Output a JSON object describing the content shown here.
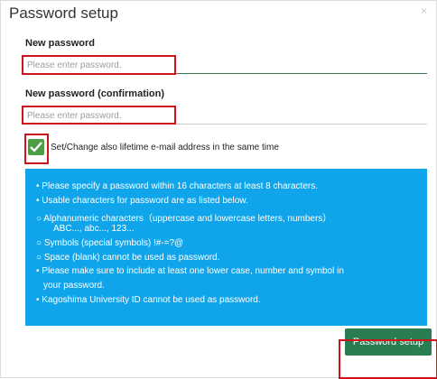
{
  "dialog": {
    "title": "Password setup",
    "close_symbol": "×"
  },
  "new_password": {
    "label": "New password",
    "placeholder": "Please enter password.",
    "value": ""
  },
  "confirm_password": {
    "label": "New password (confirmation)",
    "placeholder": "Please enter password.",
    "value": ""
  },
  "email_option": {
    "checked": true,
    "label": "Set/Change also lifetime e-mail address in the same time"
  },
  "info": {
    "lines": [
      "• Please specify a password within 16 characters at least 8 characters.",
      "• Usable characters for password are as listed below.",
      "○ Alphanumeric characters（uppercase and lowercase letters, numbers）",
      "ABC..., abc..., 123...",
      "○ Symbols (special symbols) !#-=?@",
      "○ Space (blank) cannot be used as password.",
      "• Please make sure to include at least one lower case, number and symbol in",
      "your password.",
      "• Kagoshima University ID cannot be used as password."
    ]
  },
  "actions": {
    "submit_label": "Password setup"
  },
  "colors": {
    "accent_green": "#2a7d51",
    "checkbox_green": "#4e9e47",
    "info_blue": "#10a5ea",
    "highlight_red": "#d0121b"
  }
}
